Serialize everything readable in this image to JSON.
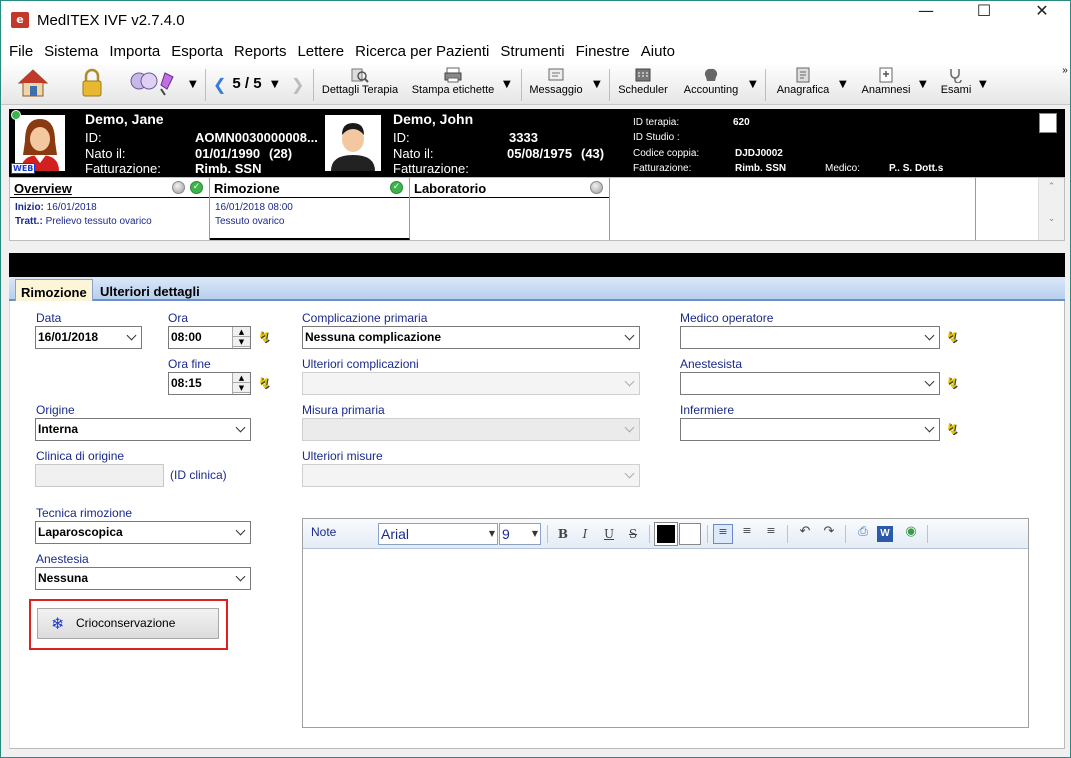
{
  "window": {
    "title": "MedITEX IVF v2.7.4.0",
    "app_icon_glyph": "e"
  },
  "menu": [
    "File",
    "Sistema",
    "Importa",
    "Esporta",
    "Reports",
    "Lettere",
    "Ricerca per Pazienti",
    "Strumenti",
    "Finestre",
    "Aiuto"
  ],
  "toolbar": {
    "pager": "5 / 5",
    "dettagli": "Dettagli Terapia",
    "stampa": "Stampa etichette",
    "messaggio": "Messaggio",
    "scheduler": "Scheduler",
    "accounting": "Accounting",
    "anagrafica": "Anagrafica",
    "anamnesi": "Anamnesi",
    "esami": "Esami"
  },
  "patient_f": {
    "name": "Demo, Jane",
    "id_label": "ID:",
    "id": "AOMN0030000008...",
    "dob_label": "Nato il:",
    "dob": "01/01/1990",
    "age": "(28)",
    "billing_label": "Fatturazione:",
    "billing": "Rimb. SSN",
    "web_badge": "WEB"
  },
  "patient_m": {
    "name": "Demo, John",
    "id_label": "ID:",
    "id": "3333",
    "dob_label": "Nato il:",
    "dob": "05/08/1975",
    "age": "(43)",
    "billing_label": "Fatturazione:"
  },
  "therapy": {
    "id_terapia_label": "ID terapia:",
    "id_terapia": "620",
    "id_studio_label": "ID Studio :",
    "codice_label": "Codice coppia:",
    "codice": "DJDJ0002",
    "fatt_label": "Fatturazione:",
    "fatt": "Rimb. SSN",
    "medico_label": "Medico:",
    "medico": "P.. S. Dott.s"
  },
  "tiles": {
    "overview": {
      "title": "Overview",
      "inizio_label": "Inizio:",
      "inizio": "16/01/2018",
      "tratt_label": "Tratt.:",
      "tratt": "Prelievo tessuto ovarico"
    },
    "rimozione": {
      "title": "Rimozione",
      "line1": "16/01/2018 08:00",
      "line2": "Tessuto ovarico"
    },
    "laboratorio": {
      "title": "Laboratorio"
    }
  },
  "tabs": [
    "Rimozione",
    "Ulteriori dettagli"
  ],
  "form": {
    "data_label": "Data",
    "data": "16/01/2018",
    "ora_label": "Ora",
    "ora": "08:00",
    "ora_fine_label": "Ora fine",
    "ora_fine": "08:15",
    "origine_label": "Origine",
    "origine": "Interna",
    "clinica_label": "Clinica di origine",
    "clinica_hint": "(ID clinica)",
    "tecnica_label": "Tecnica rimozione",
    "tecnica": "Laparoscopica",
    "anestesia_label": "Anestesia",
    "anestesia": "Nessuna",
    "compl_label": "Complicazione primaria",
    "compl": "Nessuna complicazione",
    "ult_compl_label": "Ulteriori complicazioni",
    "misura_label": "Misura primaria",
    "ult_misure_label": "Ulteriori misure",
    "medico_label": "Medico operatore",
    "anestesista_label": "Anestesista",
    "infermiere_label": "Infermiere",
    "cryo_button": "Crioconservazione"
  },
  "note": {
    "label": "Note",
    "font": "Arial",
    "size": "9"
  },
  "colors": {
    "accent_red": "#e02020",
    "label_blue": "#1a2a8a",
    "status_green": "#3cb44b"
  }
}
